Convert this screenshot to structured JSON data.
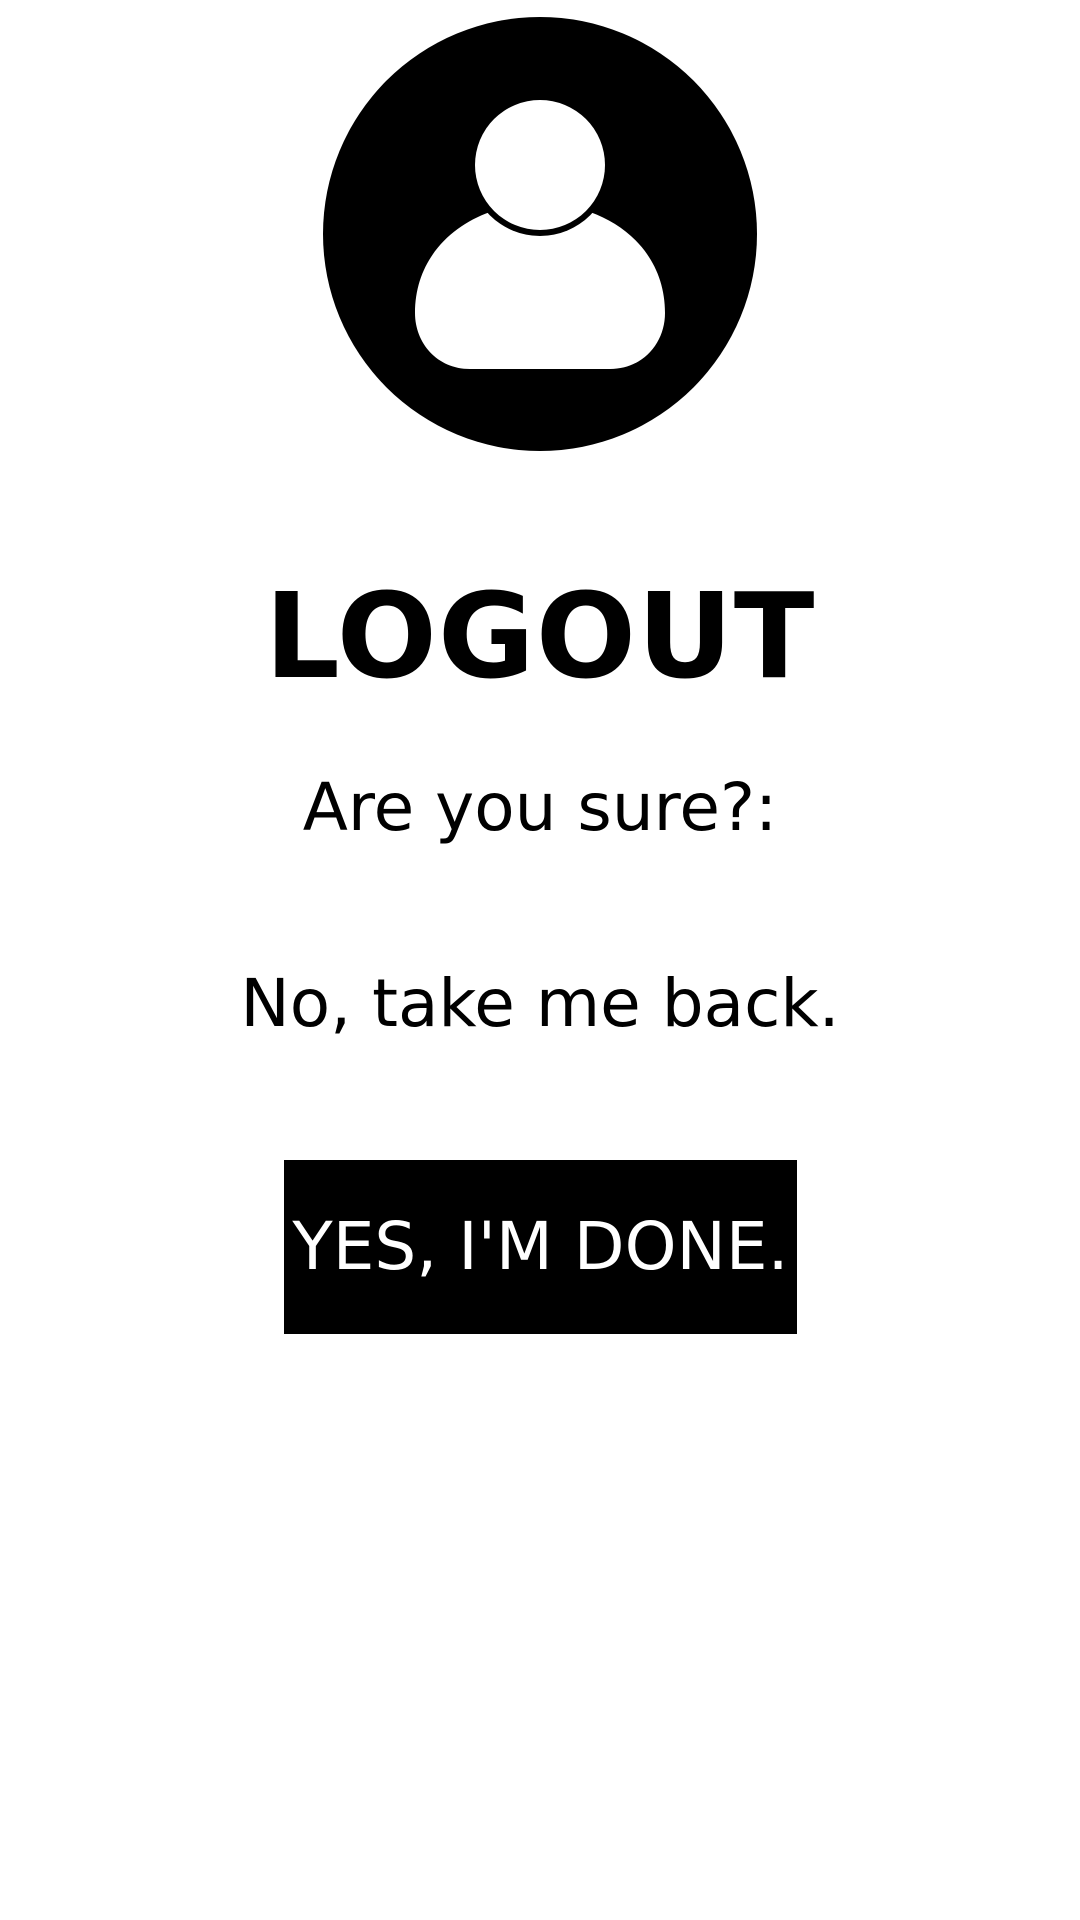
{
  "icons": {
    "avatar": "user-circle-icon"
  },
  "colors": {
    "background": "#ffffff",
    "foreground": "#000000",
    "button_background": "#000000",
    "button_text": "#ffffff"
  },
  "logout": {
    "title": "LOGOUT",
    "question": "Are you sure?:",
    "cancel_label": "No, take me back.",
    "confirm_label": "YES, I'M DONE."
  }
}
